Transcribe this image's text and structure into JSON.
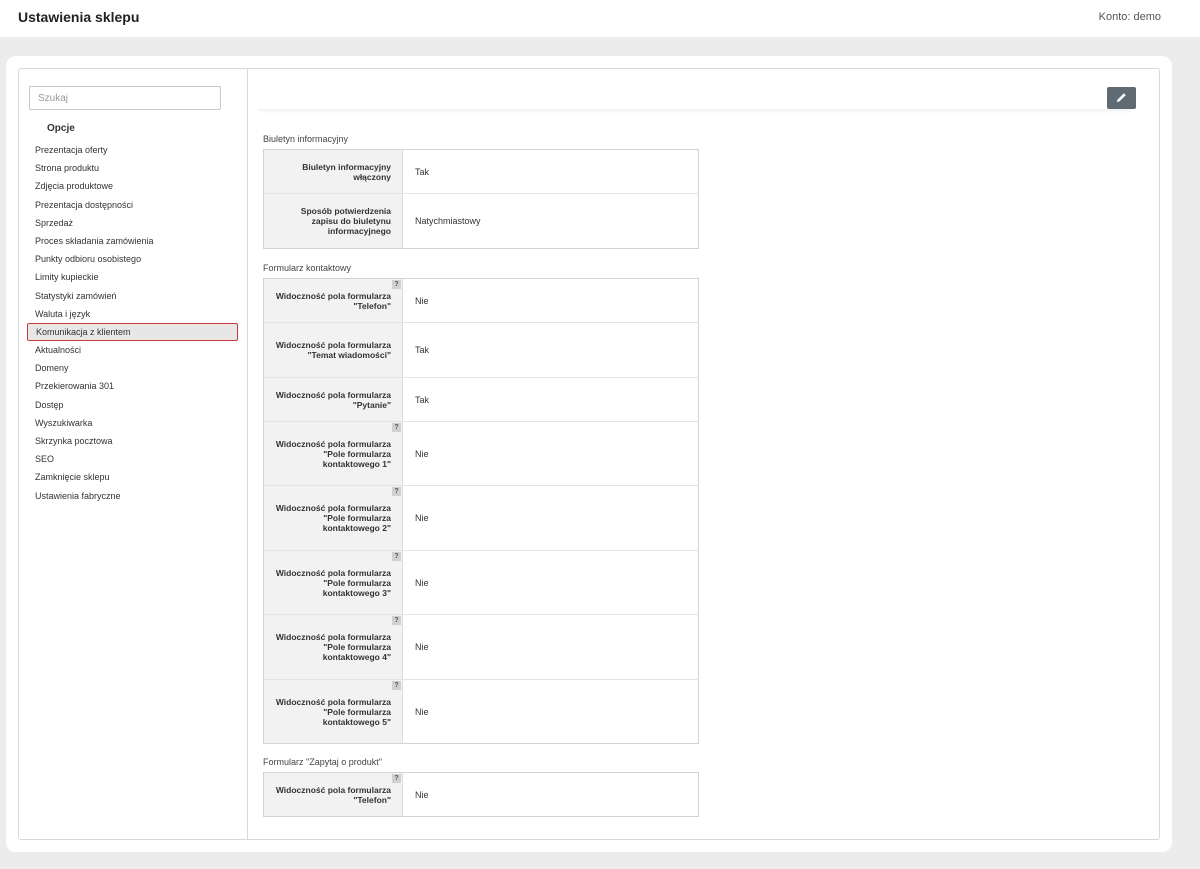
{
  "header": {
    "title": "Ustawienia sklepu",
    "account": "Konto: demo"
  },
  "sidebar": {
    "search_placeholder": "Szukaj",
    "heading": "Opcje",
    "items": [
      "Prezentacja oferty",
      "Strona produktu",
      "Zdjęcia produktowe",
      "Prezentacja dostępności",
      "Sprzedaż",
      "Proces składania zamówienia",
      "Punkty odbioru osobistego",
      "Limity kupieckie",
      "Statystyki zamówień",
      "Waluta i język",
      "Komunikacja z klientem",
      "Aktualności",
      "Domeny",
      "Przekierowania 301",
      "Dostęp",
      "Wyszukiwarka",
      "Skrzynka pocztowa",
      "SEO",
      "Zamknięcie sklepu",
      "Ustawienia fabryczne"
    ],
    "active_item": "Komunikacja z klientem"
  },
  "toolbar": {
    "edit_icon": "pencil-icon"
  },
  "help_marker": "?",
  "sections": [
    {
      "title": "Biuletyn informacyjny",
      "rows": [
        {
          "label": "Biuletyn informacyjny włączony",
          "value": "Tak",
          "help": false
        },
        {
          "label": "Sposób potwierdzenia zapisu do biuletynu informacyjnego",
          "value": "Natychmiastowy",
          "help": false
        }
      ]
    },
    {
      "title": "Formularz kontaktowy",
      "rows": [
        {
          "label": "Widoczność pola formularza \"Telefon\"",
          "value": "Nie",
          "help": true
        },
        {
          "label": "Widoczność pola formularza \"Temat wiadomości\"",
          "value": "Tak",
          "help": false
        },
        {
          "label": "Widoczność pola formularza \"Pytanie\"",
          "value": "Tak",
          "help": false
        },
        {
          "label": "Widoczność pola formularza \"Pole formularza kontaktowego 1\"",
          "value": "Nie",
          "help": true
        },
        {
          "label": "Widoczność pola formularza \"Pole formularza kontaktowego 2\"",
          "value": "Nie",
          "help": true
        },
        {
          "label": "Widoczność pola formularza \"Pole formularza kontaktowego 3\"",
          "value": "Nie",
          "help": true
        },
        {
          "label": "Widoczność pola formularza \"Pole formularza kontaktowego 4\"",
          "value": "Nie",
          "help": true
        },
        {
          "label": "Widoczność pola formularza \"Pole formularza kontaktowego 5\"",
          "value": "Nie",
          "help": true
        }
      ]
    },
    {
      "title": "Formularz \"Zapytaj o produkt\"",
      "rows": [
        {
          "label": "Widoczność pola formularza \"Telefon\"",
          "value": "Nie",
          "help": true
        }
      ]
    }
  ]
}
